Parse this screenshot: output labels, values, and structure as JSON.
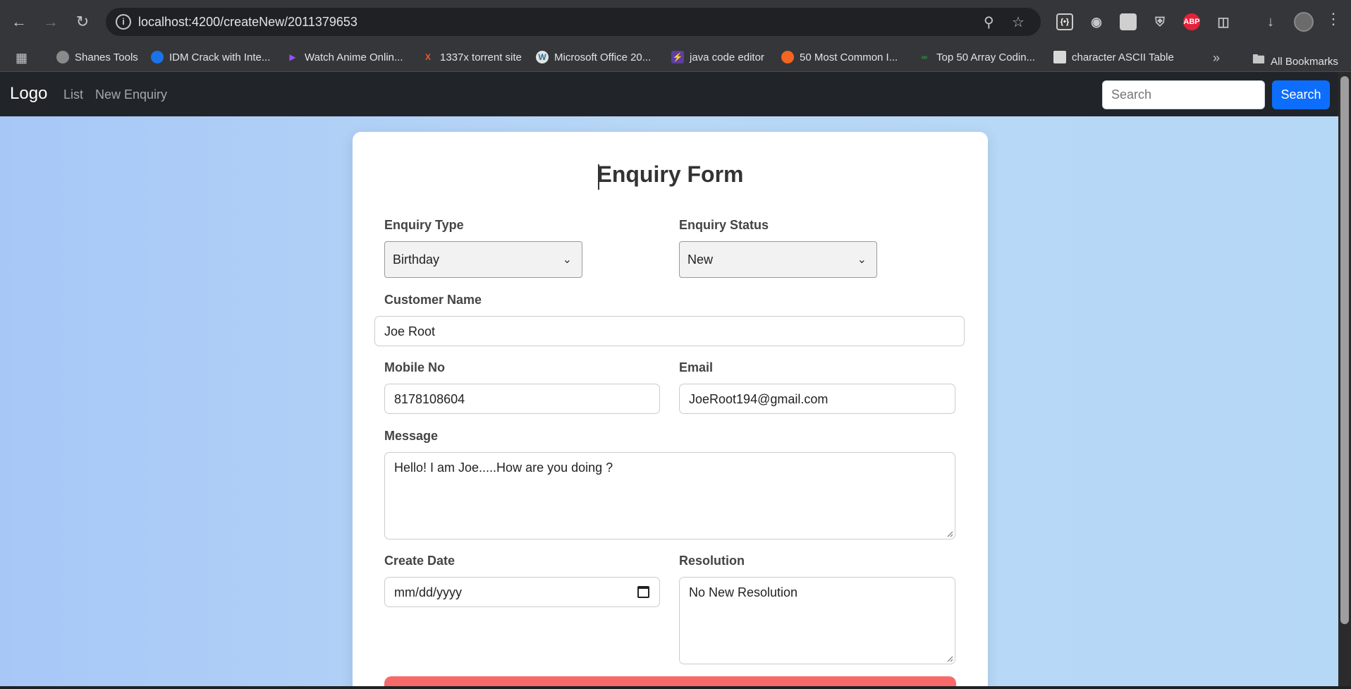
{
  "browser": {
    "url": "localhost:4200/createNew/2011379653",
    "bookmarks": [
      "Shanes Tools",
      "IDM Crack with Inte...",
      "Watch Anime Onlin...",
      "1337x torrent site",
      "Microsoft Office 20...",
      "java code editor",
      "50 Most Common I...",
      "Top 50 Array Codin...",
      "character ASCII Table"
    ],
    "all_bookmarks": "All Bookmarks",
    "extensions": [
      "tag-assistant-icon",
      "camera-icon",
      "cube-icon",
      "shield-icon",
      "adblock-plus-icon",
      "puzzle-icon"
    ],
    "ext_abp_label": "ABP"
  },
  "navbar": {
    "brand": "Logo",
    "links": [
      "List",
      "New Enquiry"
    ],
    "search_placeholder": "Search",
    "search_button": "Search"
  },
  "form": {
    "title": "Enquiry Form",
    "enquiry_type": {
      "label": "Enquiry Type",
      "value": "Birthday"
    },
    "enquiry_status": {
      "label": "Enquiry Status",
      "value": "New"
    },
    "customer_name": {
      "label": "Customer Name",
      "value": "Joe Root"
    },
    "mobile_no": {
      "label": "Mobile No",
      "value": "8178108604"
    },
    "email": {
      "label": "Email",
      "value": "JoeRoot194@gmail.com"
    },
    "message": {
      "label": "Message",
      "value": "Hello! I am Joe.....How are you doing ?"
    },
    "create_date": {
      "label": "Create Date",
      "placeholder": "mm/dd/yyyy"
    },
    "resolution": {
      "label": "Resolution",
      "value": "No New Resolution"
    }
  },
  "colors": {
    "navbar_bg": "#212529",
    "primary": "#0d6efd",
    "submit": "#f86a6a",
    "page_bg": "#b5d5f6"
  }
}
